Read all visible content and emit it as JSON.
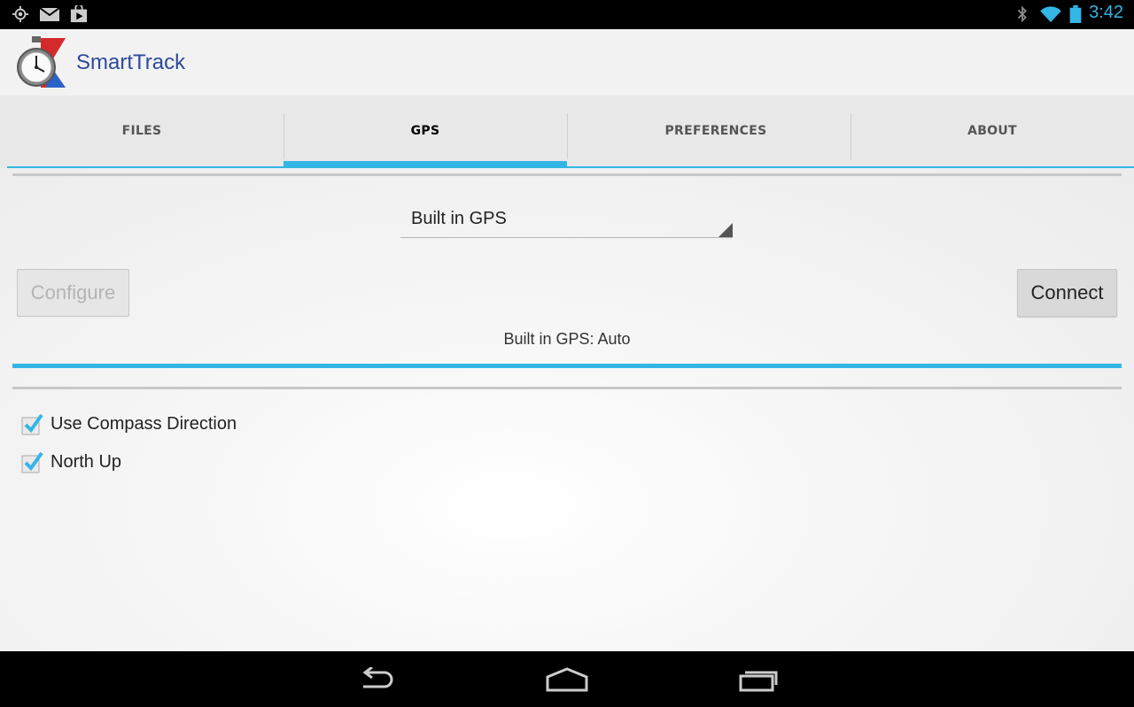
{
  "status_bar": {
    "time": "3:42",
    "left_icons": [
      "gps-icon",
      "gmail-icon",
      "play-store-icon"
    ],
    "right_icons": [
      "bluetooth-icon",
      "wifi-icon",
      "battery-icon"
    ],
    "accent": "#33b5e5"
  },
  "app": {
    "title": "SmartTrack",
    "title_color": "#2b4a9c",
    "logo_icon": "stopwatch-logo-icon"
  },
  "tabs": [
    {
      "label": "FILES",
      "selected": false
    },
    {
      "label": "GPS",
      "selected": true
    },
    {
      "label": "PREFERENCES",
      "selected": false
    },
    {
      "label": "ABOUT",
      "selected": false
    }
  ],
  "gps": {
    "source_selected": "Built in GPS",
    "configure_label": "Configure",
    "configure_enabled": false,
    "connect_label": "Connect",
    "connect_enabled": true,
    "status": "Built in GPS: Auto"
  },
  "options": [
    {
      "label": "Use Compass Direction",
      "checked": true
    },
    {
      "label": "North Up",
      "checked": true
    }
  ],
  "nav_bar": {
    "buttons": [
      "back-icon",
      "home-icon",
      "recents-icon"
    ]
  }
}
